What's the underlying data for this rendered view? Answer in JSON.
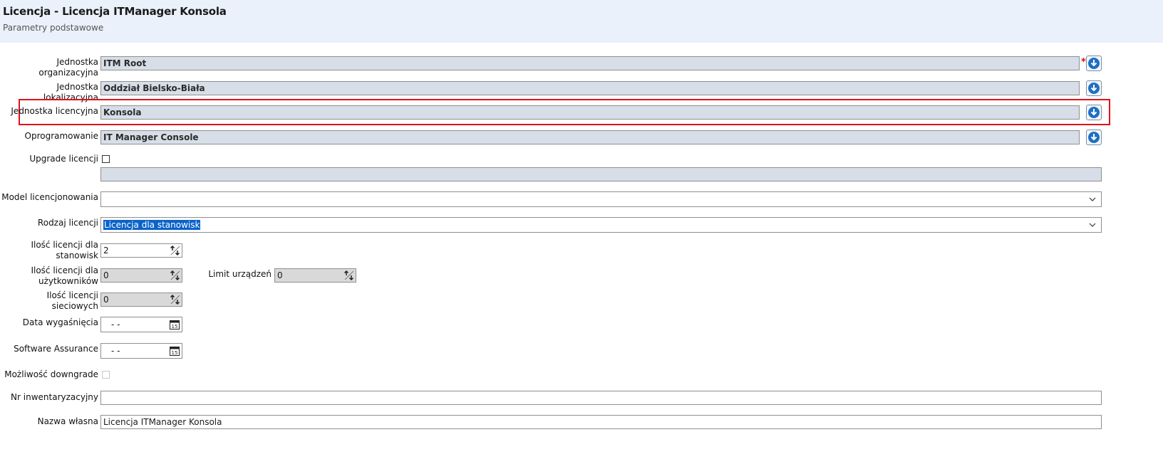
{
  "header": {
    "title": "Licencja - Licencja ITManager Konsola",
    "subtitle": "Parametry podstawowe"
  },
  "form": {
    "org_unit": {
      "label": "Jednostka organizacyjna",
      "value": "ITM Root",
      "required_mark": "*"
    },
    "loc_unit": {
      "label": "Jednostka lokalizacyjna",
      "value": "Oddział Bielsko-Biała"
    },
    "lic_unit": {
      "label": "Jednostka licencyjna",
      "value": "Konsola"
    },
    "software": {
      "label": "Oprogramowanie",
      "value": "IT Manager Console"
    },
    "upgrade": {
      "label": "Upgrade licencji",
      "checked": false,
      "value": ""
    },
    "model": {
      "label": "Model licencjonowania",
      "value": ""
    },
    "type": {
      "label": "Rodzaj licencji",
      "value": "Licencja dla stanowisk"
    },
    "qty_stations": {
      "label_line1": "Ilość licencji dla",
      "label_line2": "stanowisk",
      "value": "2"
    },
    "qty_users": {
      "label_line1": "Ilość licencji dla",
      "label_line2": "użytkowników",
      "value": "0"
    },
    "device_limit": {
      "label": "Limit urządzeń",
      "value": "0"
    },
    "qty_network": {
      "label": "Ilość licencji sieciowych",
      "value": "0"
    },
    "expiry": {
      "label": "Data wygaśnięcia",
      "value": "-  -"
    },
    "assurance": {
      "label": "Software Assurance",
      "value": "-  -"
    },
    "downgrade": {
      "label": "Możliwość downgrade",
      "checked": false
    },
    "inventory": {
      "label": "Nr inwentaryzacyjny",
      "value": ""
    },
    "own_name": {
      "label": "Nazwa własna",
      "value": "Licencja ITManager Konsola"
    }
  },
  "colors": {
    "header_bg": "#eaf1fa",
    "lookup_bg": "#d7dee8",
    "accent_blue": "#1f6fc2",
    "highlight_red": "#e0121b",
    "selection_blue": "#0a63c9"
  },
  "icons": {
    "lookup": "arrow-down-circle-icon",
    "dropdown": "chevron-down-icon",
    "spinner": "spin-arrows-icon",
    "calendar": "calendar-icon"
  }
}
